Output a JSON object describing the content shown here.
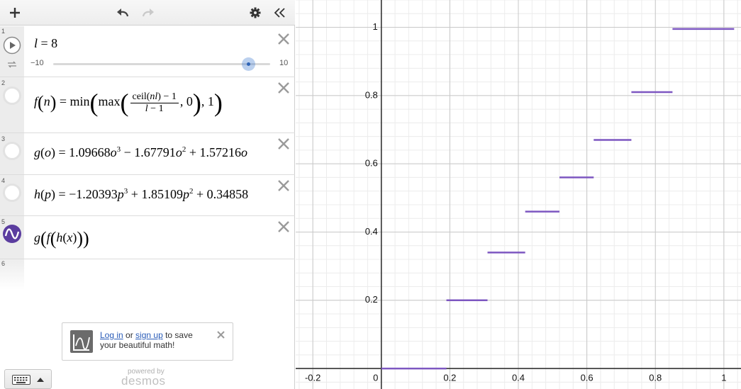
{
  "expressions": [
    {
      "num": "1",
      "latex_lhs": "l",
      "value": "8",
      "slider_min": "−10",
      "slider_max": "10",
      "slider_fraction": 0.9
    },
    {
      "num": "2"
    },
    {
      "num": "3"
    },
    {
      "num": "4"
    },
    {
      "num": "5",
      "color": "#5b3d9f"
    },
    {
      "num": "6"
    }
  ],
  "login": {
    "log_in": "Log in",
    "or": " or ",
    "sign_up": "sign up",
    "rest": " to save",
    "line2": "your beautiful math!"
  },
  "branding": {
    "powered_by": "powered by",
    "name": "desmos"
  },
  "graph": {
    "x_ticks": [
      "-0.2",
      "0",
      "0.2",
      "0.4",
      "0.6",
      "0.8",
      "1"
    ],
    "y_ticks": [
      "0.2",
      "0.4",
      "0.6",
      "0.8",
      "1"
    ],
    "curve_color": "#7d57c1"
  },
  "chart_data": {
    "type": "line",
    "xlim": [
      -0.25,
      1.05
    ],
    "ylim": [
      -0.06,
      1.08
    ],
    "segments": [
      {
        "x": [
          0.0,
          0.19
        ],
        "y": 0.0
      },
      {
        "x": [
          0.19,
          0.31
        ],
        "y": 0.2
      },
      {
        "x": [
          0.31,
          0.42
        ],
        "y": 0.34
      },
      {
        "x": [
          0.42,
          0.52
        ],
        "y": 0.46
      },
      {
        "x": [
          0.52,
          0.62
        ],
        "y": 0.56
      },
      {
        "x": [
          0.62,
          0.73
        ],
        "y": 0.67
      },
      {
        "x": [
          0.73,
          0.85
        ],
        "y": 0.81
      },
      {
        "x": [
          0.85,
          1.03
        ],
        "y": 0.995
      }
    ]
  }
}
